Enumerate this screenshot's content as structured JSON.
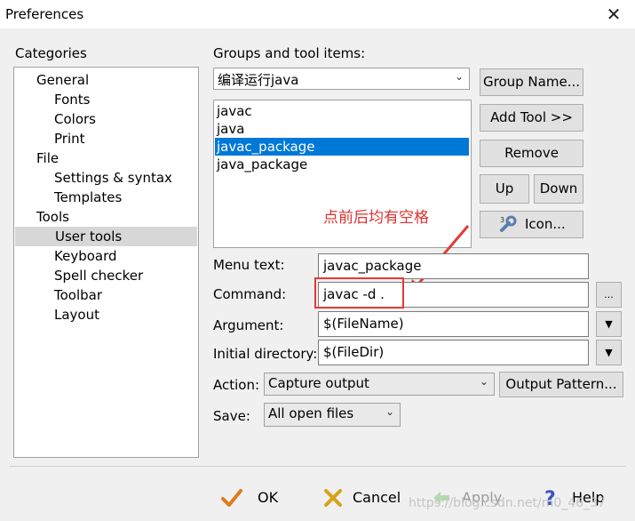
{
  "window": {
    "title": "Preferences",
    "close_glyph": "✕"
  },
  "categories": {
    "label": "Categories",
    "items": [
      {
        "label": "General",
        "level": 1
      },
      {
        "label": "Fonts",
        "level": 2
      },
      {
        "label": "Colors",
        "level": 2
      },
      {
        "label": "Print",
        "level": 2
      },
      {
        "label": "File",
        "level": 1
      },
      {
        "label": "Settings & syntax",
        "level": 2
      },
      {
        "label": "Templates",
        "level": 2
      },
      {
        "label": "Tools",
        "level": 1
      },
      {
        "label": "User tools",
        "level": 2,
        "selected": true
      },
      {
        "label": "Keyboard",
        "level": 2
      },
      {
        "label": "Spell checker",
        "level": 2
      },
      {
        "label": "Toolbar",
        "level": 2
      },
      {
        "label": "Layout",
        "level": 2
      }
    ]
  },
  "groups": {
    "label": "Groups and tool items:",
    "selected_group": "编译运行java",
    "tools": [
      {
        "label": "javac"
      },
      {
        "label": "java"
      },
      {
        "label": "javac_package",
        "selected": true
      },
      {
        "label": "java_package"
      }
    ]
  },
  "side_buttons": {
    "group_name": "Group Name...",
    "add_tool": "Add Tool >>",
    "remove": "Remove",
    "up": "Up",
    "down": "Down",
    "icon": "Icon..."
  },
  "form": {
    "menu_text_label": "Menu text:",
    "menu_text_value": "javac_package",
    "command_label": "Command:",
    "command_value": "javac -d .",
    "command_browse": "...",
    "argument_label": "Argument:",
    "argument_value": "$(FileName)",
    "initial_dir_label": "Initial directory:",
    "initial_dir_value": "$(FileDir)",
    "action_label": "Action:",
    "action_value": "Capture output",
    "output_pattern_button": "Output Pattern...",
    "save_label": "Save:",
    "save_value": "All open files"
  },
  "annotation": {
    "text": "点前后均有空格",
    "color": "#e03030"
  },
  "footer": {
    "ok": "OK",
    "cancel": "Cancel",
    "apply": "Apply",
    "help": "Help"
  },
  "watermark": "https://blog.csdn.net/m0_46_37",
  "colors": {
    "selection": "#0078d7",
    "annotation_red": "#e53935"
  }
}
